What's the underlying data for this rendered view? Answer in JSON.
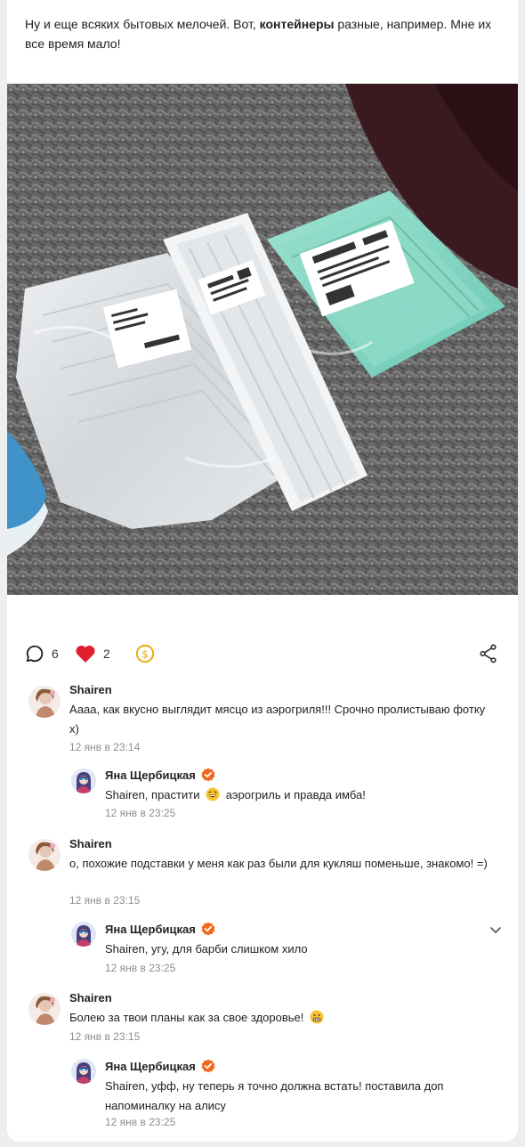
{
  "post": {
    "text_before": "Ну и еще всяких бытовых мелочей. Вот, ",
    "text_bold": "контейнеры",
    "text_after": " разные, например. Мне их все время мало!",
    "photo_label_1": "",
    "photo_label_2": ""
  },
  "actions": {
    "comments_count": "6",
    "likes_count": "2",
    "accent_like": "#e0202e",
    "accent_coin": "#f0a500"
  },
  "comments": [
    {
      "author": "Shairen",
      "text": "Аааа, как вкусно выглядит мясцо из аэрогриля!!! Срочно пролистываю фотку х)",
      "time": "12 янв в 23:14",
      "reply": {
        "author": "Яна Щербицкая",
        "text_before": "Shairen, прастити ",
        "text_after": " аэрогриль и правда имба!",
        "time": "12 янв в 23:25"
      }
    },
    {
      "author": "Shairen",
      "text": "о, похожие подставки у меня как раз были для кукляш поменьше, знакомо! =)",
      "time": "12 янв в 23:15",
      "reply": {
        "author": "Яна Щербицкая",
        "text_before": "Shairen, угу, для барби слишком хило",
        "text_after": "",
        "time": "12 янв в 23:25"
      }
    },
    {
      "author": "Shairen",
      "text": "Болею за твои планы как за свое здоровье! ",
      "time": "12 янв в 23:15",
      "reply": {
        "author": "Яна Щербицкая",
        "text_before": "Shairen, уфф, ну теперь я точно должна встать! поставила доп напоминалку на алису",
        "text_after": "",
        "time": "12 янв в 23:25"
      }
    }
  ]
}
